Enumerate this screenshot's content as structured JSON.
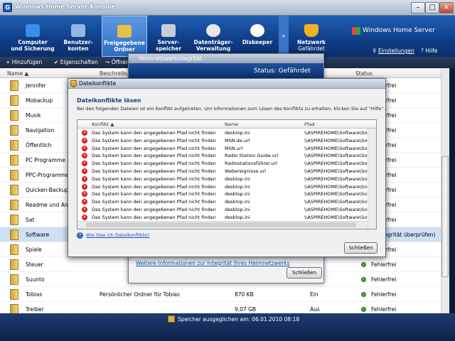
{
  "window": {
    "title": "Windows Home Server-Konsole",
    "app_icon": "G"
  },
  "nav": {
    "items": [
      {
        "label1": "Computer",
        "label2": "und Sicherung",
        "icon_color": "#3a8ee6"
      },
      {
        "label1": "Benutzer-",
        "label2": "konten",
        "icon_color": "#8fb7e8"
      },
      {
        "label1": "Freigegebene",
        "label2": "Ordner",
        "icon_color": "#e6c04a",
        "active": true
      },
      {
        "label1": "Server-",
        "label2": "speicher",
        "icon_color": "#c8ccd4"
      },
      {
        "label1": "Datenträger-",
        "label2": "Verwaltung",
        "icon_color": "#e8e8e8"
      },
      {
        "label1": "Diskeeper",
        "label2": "",
        "icon_color": "#ffffff"
      }
    ],
    "scroll": "»",
    "network": {
      "label1": "Netzwerk",
      "label2": "Gefährdet",
      "icon_color": "#f0b020"
    },
    "brand": "Windows Home Server",
    "settings": "Einstellungen",
    "help": "Hilfe"
  },
  "toolbar": {
    "add": "Hinzufügen",
    "props": "Eigenschaften",
    "open": "Öffnen"
  },
  "list": {
    "headers": {
      "name": "Name",
      "desc": "Beschreibung",
      "status": "Status"
    },
    "rows": [
      {
        "name": "Jennifer",
        "status": "Fehlerfrei"
      },
      {
        "name": "Mobackup",
        "status": "Fehlerfrei"
      },
      {
        "name": "Musik",
        "status": "Fehlerfrei"
      },
      {
        "name": "Navigation",
        "status": "Fehlerfrei"
      },
      {
        "name": "Öffentlich",
        "status": "Fehlerfrei"
      },
      {
        "name": "PC Programme",
        "status": "Fehlerfrei"
      },
      {
        "name": "PPC-Programme",
        "status": "Fehlerfrei"
      },
      {
        "name": "Quicken-Backup",
        "status": "Fehlerfrei"
      },
      {
        "name": "Readme und Anleitu",
        "status": "Fehlerfrei"
      },
      {
        "name": "Sat",
        "status": "Fehlerfrei"
      },
      {
        "name": "Software",
        "status": "r (Integrität überprüfen)",
        "selected": true
      },
      {
        "name": "Spiele",
        "status": "Fehlerfrei"
      },
      {
        "name": "Steuer",
        "status": "Fehlerfrei"
      },
      {
        "name": "Suunto",
        "status": "Fehlerfrei"
      },
      {
        "name": "Tobias",
        "desc": "Persönlicher Ordner für Tobias",
        "size": "870 KB",
        "dup": "Ein",
        "status": "Fehlerfrei"
      },
      {
        "name": "Treiber",
        "desc": "",
        "size": "9,07 GB",
        "dup": "Aus",
        "status": "Fehlerfrei"
      }
    ]
  },
  "statusbar": {
    "text": "Speicher ausgeglichen am: 06.01.2010 08:18"
  },
  "integrity_dialog": {
    "title": "Heimnetzwerkintegrität",
    "header": "Status: Gefährdet",
    "link": "Weitere Informationen zur Integrität Ihres Heimnetzwerks",
    "close": "Schließen"
  },
  "conflict_dialog": {
    "title": "Dateikonflikte",
    "heading": "Dateikonflikte lösen",
    "description": "Bei den folgenden Dateien ist ein Konflikt aufgetreten. Um Informationen zum Lösen des Konflikts zu erhalten, klicken Sie auf \"Hilfe\".",
    "columns": {
      "conflict": "Konflikt",
      "name": "Name",
      "path": "Pfad"
    },
    "rows": [
      {
        "conflict": "Das System kann den angegebenen Pfad nicht finden",
        "name": "desktop.ini",
        "path": "\\\\ASPIREHOME\\Software\\Soft"
      },
      {
        "conflict": "Das System kann den angegebenen Pfad nicht finden",
        "name": "MSN.de.url",
        "path": "\\\\ASPIREHOME\\Software\\Soft"
      },
      {
        "conflict": "Das System kann den angegebenen Pfad nicht finden",
        "name": "MSN.url",
        "path": "\\\\ASPIREHOME\\Software\\Soft"
      },
      {
        "conflict": "Das System kann den angegebenen Pfad nicht finden",
        "name": "Radio Station Guide.url",
        "path": "\\\\ASPIREHOME\\Software\\Soft"
      },
      {
        "conflict": "Das System kann den angegebenen Pfad nicht finden",
        "name": "Radiostationsführer.url",
        "path": "\\\\ASPIREHOME\\Software\\Soft"
      },
      {
        "conflict": "Das System kann den angegebenen Pfad nicht finden",
        "name": "Webereignisse.url",
        "path": "\\\\ASPIREHOME\\Software\\Soft"
      },
      {
        "conflict": "Das System kann den angegebenen Pfad nicht finden",
        "name": "desktop.ini",
        "path": "\\\\ASPIREHOME\\Software\\Soft"
      },
      {
        "conflict": "Das System kann den angegebenen Pfad nicht finden",
        "name": "desktop.ini",
        "path": "\\\\ASPIREHOME\\Software\\Soft"
      },
      {
        "conflict": "Das System kann den angegebenen Pfad nicht finden",
        "name": "desktop.ini",
        "path": "\\\\ASPIREHOME\\Software\\Soft"
      },
      {
        "conflict": "Das System kann den angegebenen Pfad nicht finden",
        "name": "desktop.ini",
        "path": "\\\\ASPIREHOME\\Software\\Soft"
      },
      {
        "conflict": "Das System kann den angegebenen Pfad nicht finden",
        "name": "desktop.ini",
        "path": "\\\\ASPIREHOME\\Software\\Soft"
      },
      {
        "conflict": "Das System kann den angegebenen Pfad nicht finden",
        "name": "desktop.ini",
        "path": "\\\\ASPIREHOME\\Software\\Soft"
      }
    ],
    "help_link": "Wie löse ich Dateikonflikte?",
    "close": "Schließen"
  }
}
